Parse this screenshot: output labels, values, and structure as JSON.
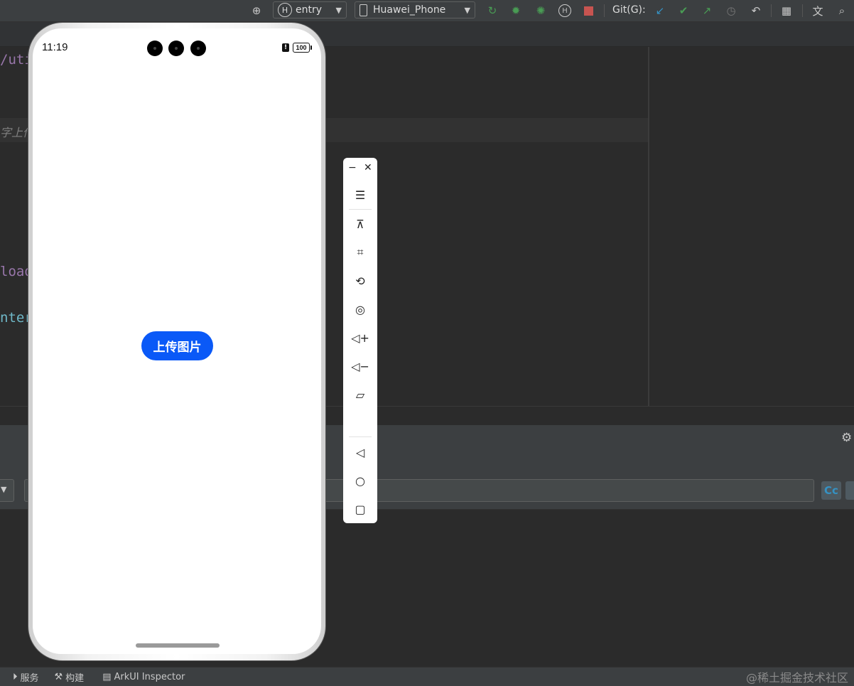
{
  "toolbar": {
    "entry_label": "entry",
    "device_label": "Huawei_Phone",
    "git_label": "Git(G):"
  },
  "editor": {
    "code_lines": [
      "/uti",
      "字上传",
      "load",
      "nter"
    ]
  },
  "phone": {
    "time": "11:19",
    "battery": "100",
    "upload_button_label": "上传图片"
  },
  "statusbar": {
    "items": [
      "服务",
      "构建",
      "ArkUI Inspector"
    ],
    "watermark": "@稀土掘金技术社区"
  },
  "panel": {
    "case_toggle": "Cc"
  },
  "colors": {
    "accent_button": "#0a59f7",
    "ide_background": "#2b2b2b",
    "toolbar_background": "#3c3f41",
    "run_green": "#499c54",
    "stop_red": "#c75450"
  }
}
